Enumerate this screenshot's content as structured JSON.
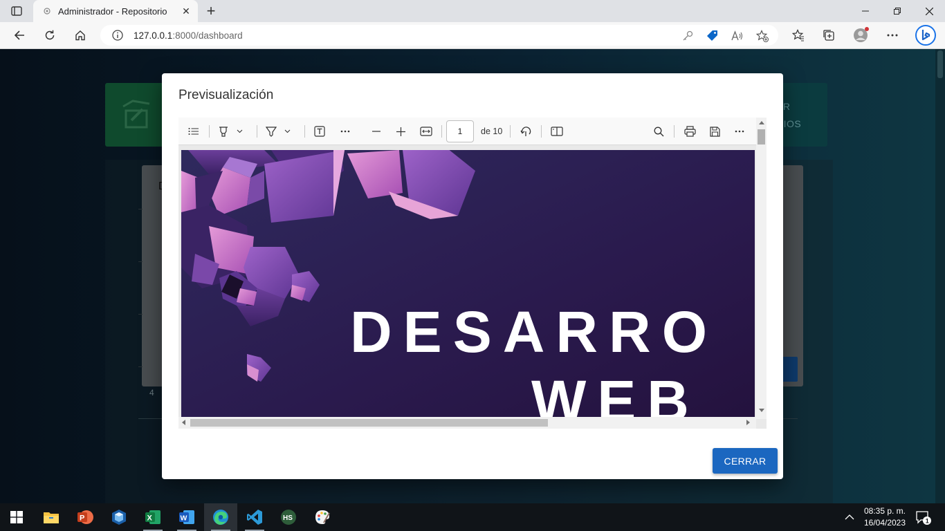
{
  "browser": {
    "tab_title": "Administrador - Repositorio",
    "url_host": "127.0.0.1",
    "url_rest": ":8000/dashboard"
  },
  "background": {
    "card_right_line1": "AR",
    "card_right_line2": "RIOS",
    "panel_label": "D",
    "panel_button": "R",
    "panel_number": "4"
  },
  "modal": {
    "title": "Previsualización",
    "close_button": "CERRAR"
  },
  "pdf_viewer": {
    "page_current": "1",
    "page_total": "de 10",
    "page_heading_line1": "DESARRO",
    "page_heading_line2": "WEB",
    "page_background_color": "#2d1b4f"
  },
  "taskbar": {
    "time": "08:35 p. m.",
    "date": "16/04/2023",
    "notification_count": "1",
    "apps": [
      "file-explorer",
      "powerpoint",
      "virtualbox",
      "excel",
      "word",
      "edge",
      "vscode",
      "hs-app",
      "paint"
    ]
  },
  "colors": {
    "accent": "#1b67c0",
    "modal_bg": "#ffffff",
    "taskbar_bg": "#101418"
  }
}
